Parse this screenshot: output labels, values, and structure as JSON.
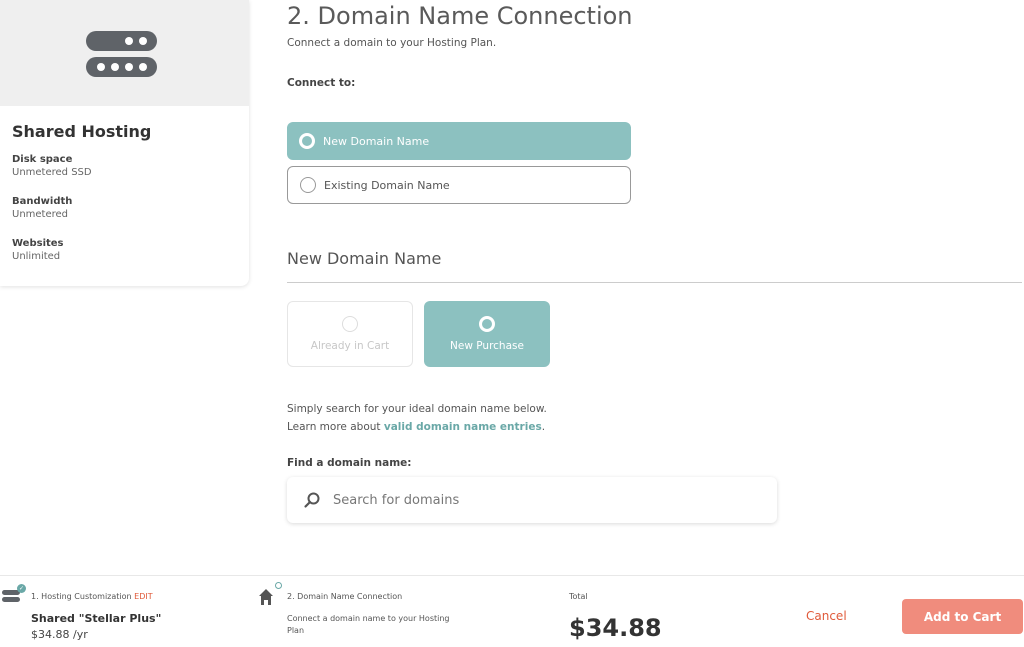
{
  "plan": {
    "title": "Shared Hosting",
    "specs": [
      {
        "label": "Disk space",
        "value": "Unmetered SSD"
      },
      {
        "label": "Bandwidth",
        "value": "Unmetered"
      },
      {
        "label": "Websites",
        "value": "Unlimited"
      }
    ],
    "icon": "server-icon"
  },
  "main": {
    "title": "2. Domain Name Connection",
    "subtitle": "Connect a domain to your Hosting Plan.",
    "connect_label": "Connect to:",
    "options": [
      {
        "label": "New Domain Name",
        "selected": true
      },
      {
        "label": "Existing Domain Name",
        "selected": false
      }
    ],
    "section_title": "New Domain Name",
    "tiles": [
      {
        "label": "Already in Cart",
        "state": "disabled"
      },
      {
        "label": "New Purchase",
        "state": "selected"
      }
    ],
    "info_line1": "Simply search for your ideal domain name below.",
    "info_line2_prefix": "Learn more about ",
    "info_link": "valid domain name entries",
    "info_line2_suffix": ".",
    "find_label": "Find a domain name:",
    "search_placeholder": "Search for domains"
  },
  "bottom": {
    "step1": {
      "title": "1. Hosting Customization",
      "edit": "EDIT",
      "name": "Shared \"Stellar Plus\"",
      "price": "$34.88 /yr"
    },
    "step2": {
      "title": "2. Domain Name Connection",
      "desc": "Connect a domain name to your Hosting Plan"
    },
    "total_label": "Total",
    "total_value": "$34.88",
    "cancel_label": "Cancel",
    "add_to_cart_label": "Add to Cart"
  },
  "colors": {
    "accent": "#8cc1c0",
    "cta": "#f08c7d",
    "link_red": "#e05a3a"
  }
}
